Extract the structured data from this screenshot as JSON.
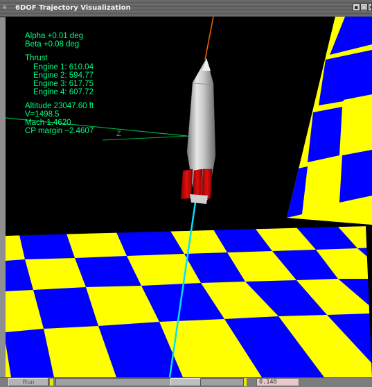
{
  "window": {
    "title": "6DOF Trajectory Visualization",
    "menu_glyph": "≡",
    "buttons": [
      "▪",
      "□",
      "×"
    ]
  },
  "hud": {
    "alpha": "Alpha  +0.01 deg",
    "beta": "Beta  +0.08 deg",
    "thrust_label": "Thrust",
    "engines": [
      "Engine 1: 610.04",
      "Engine 2: 594.77",
      "Engine 3: 617.75",
      "Engine 4: 607.72"
    ],
    "altitude": "Altitude 23047.60 ft",
    "velocity": "V=1498.5",
    "mach": "Mach 1.4620",
    "cp_margin": "CP margin −2.4607",
    "axis_label": "Z"
  },
  "colors": {
    "hud_text": "#00ff80",
    "checker_yellow": "#ffff00",
    "checker_blue": "#0000ff",
    "rocket_body": "#c8c8c8",
    "fins": "#cc0000",
    "exhaust_trail": "#00e0ff",
    "nose_trail": "#ff6000"
  },
  "controls": {
    "run_label": "Run",
    "time_value": "0.148",
    "slider_position": 0.73
  }
}
